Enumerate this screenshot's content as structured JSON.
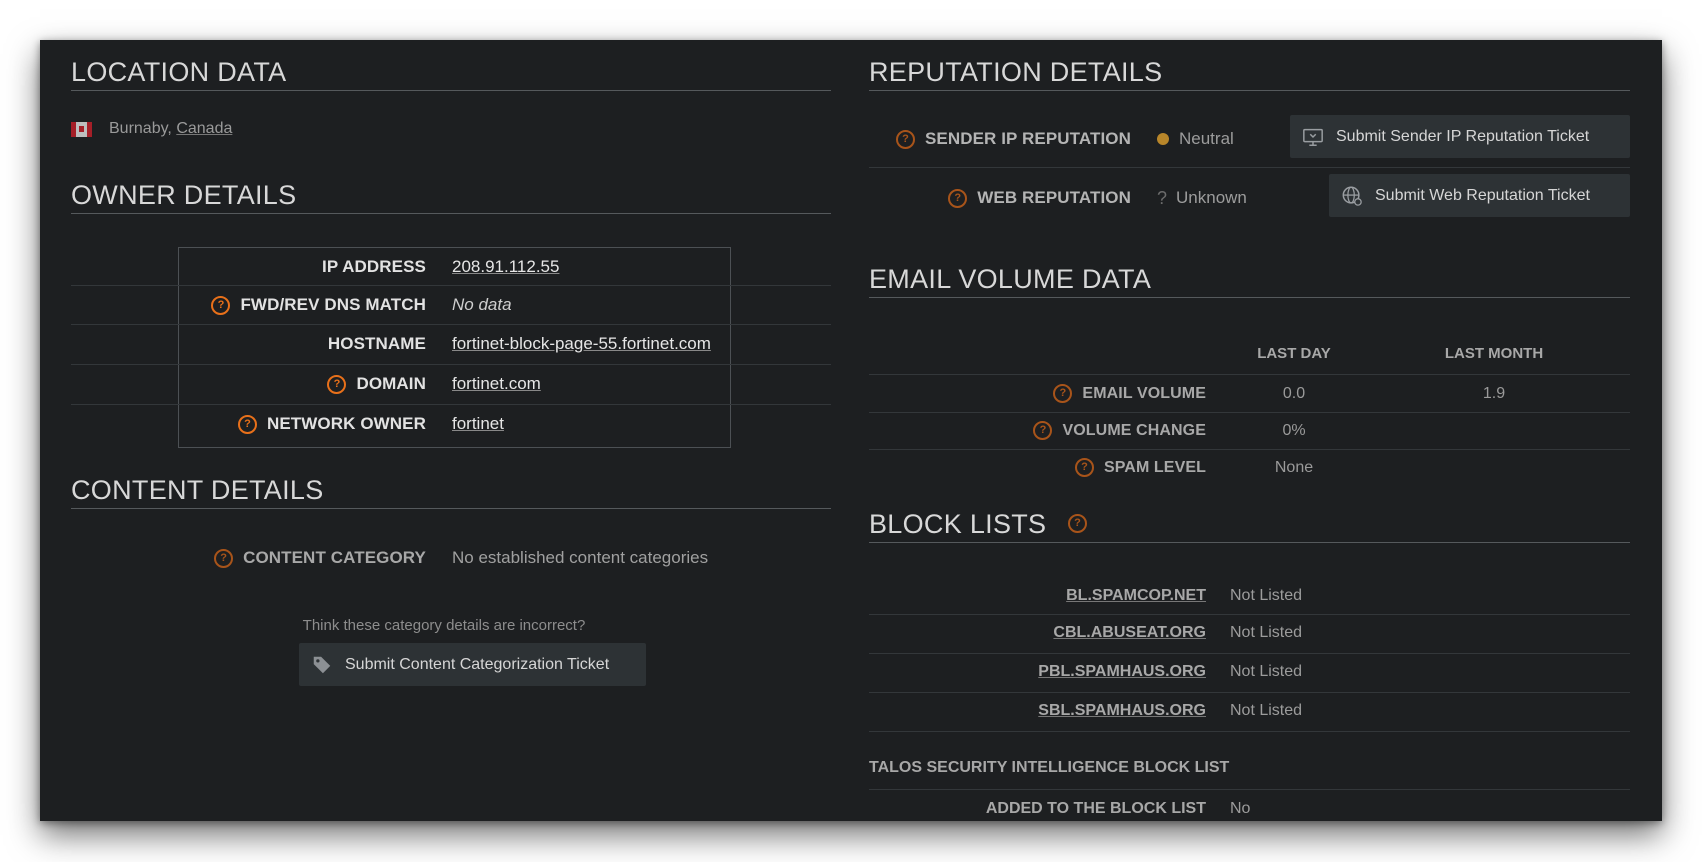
{
  "location": {
    "section_title": "LOCATION DATA",
    "flag_icon": "canada-flag-icon",
    "city": "Burnaby,",
    "country": "Canada"
  },
  "owner": {
    "section_title": "OWNER DETAILS",
    "rows": [
      {
        "label": "IP ADDRESS",
        "value": "208.91.112.55",
        "help": false
      },
      {
        "label": "FWD/REV DNS MATCH",
        "value": "No data",
        "help": true
      },
      {
        "label": "HOSTNAME",
        "value": "fortinet-block-page-55.fortinet.com",
        "help": false
      },
      {
        "label": "DOMAIN",
        "value": "fortinet.com",
        "help": true
      },
      {
        "label": "NETWORK OWNER",
        "value": "fortinet",
        "help": true
      }
    ]
  },
  "content": {
    "section_title": "CONTENT DETAILS",
    "category_label": "CONTENT CATEGORY",
    "category_value": "No established content categories",
    "incorrect_prompt": "Think these category details are incorrect?",
    "submit_button": "Submit Content Categorization Ticket"
  },
  "reputation": {
    "section_title": "REPUTATION DETAILS",
    "sender_label": "SENDER IP REPUTATION",
    "sender_status": "Neutral",
    "sender_status_color": "#b8862a",
    "sender_button": "Submit Sender IP Reputation Ticket",
    "web_label": "WEB REPUTATION",
    "web_status_icon": "?",
    "web_status": "Unknown",
    "web_button": "Submit Web Reputation Ticket"
  },
  "email_volume": {
    "section_title": "EMAIL VOLUME DATA",
    "col_last_day": "LAST DAY",
    "col_last_month": "LAST MONTH",
    "rows": [
      {
        "label": "EMAIL VOLUME",
        "last_day": "0.0",
        "last_month": "1.9"
      },
      {
        "label": "VOLUME CHANGE",
        "last_day": "0%",
        "last_month": ""
      },
      {
        "label": "SPAM LEVEL",
        "last_day": "None",
        "last_month": ""
      }
    ]
  },
  "block_lists": {
    "section_title": "BLOCK LISTS",
    "rows": [
      {
        "label": "BL.SPAMCOP.NET",
        "value": "Not Listed"
      },
      {
        "label": "CBL.ABUSEAT.ORG",
        "value": "Not Listed"
      },
      {
        "label": "PBL.SPAMHAUS.ORG",
        "value": "Not Listed"
      },
      {
        "label": "SBL.SPAMHAUS.ORG",
        "value": "Not Listed"
      }
    ],
    "talos_title": "TALOS SECURITY INTELLIGENCE BLOCK LIST",
    "added_label": "ADDED TO THE BLOCK LIST",
    "added_value": "No"
  },
  "colors": {
    "background": "#1d1f21",
    "help_accent": "#e8701a",
    "button_bg": "#2d3235"
  }
}
